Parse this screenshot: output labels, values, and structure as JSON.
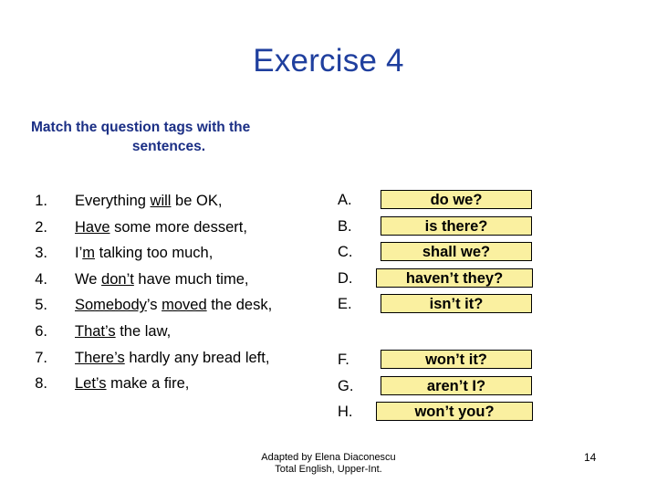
{
  "slide": {
    "title": "Exercise 4",
    "title_color": "#1F3F9E",
    "subtitle_line1": "Match the question tags with the",
    "subtitle_line2": "sentences.",
    "subtitle_color": "#1B2F85",
    "background_color": "#FFFFFF"
  },
  "questions": [
    {
      "num": "1.",
      "pre": "Everything ",
      "underline": "will",
      "post": " be OK,"
    },
    {
      "num": "2.",
      "pre": "",
      "underline": "Have",
      "post": " some more dessert,"
    },
    {
      "num": "3.",
      "pre": "I’",
      "underline": "m",
      "post": " talking too much,"
    },
    {
      "num": "4.",
      "pre": "We ",
      "underline": "don’t",
      "post": " have much time,"
    },
    {
      "num": "5.",
      "pre": "",
      "underline": "Somebody",
      "mid": "’s ",
      "underline2": "moved",
      "post": " the desk,"
    },
    {
      "num": "6.",
      "pre": "",
      "underline": "That’s",
      "post": " the law,"
    },
    {
      "num": "7.",
      "pre": "",
      "underline": "There’s",
      "post": " hardly any bread left,"
    },
    {
      "num": "8.",
      "pre": "",
      "underline": "Let’s",
      "post": " make a fire,"
    }
  ],
  "answers": [
    {
      "letter": "A.",
      "text": "do we?",
      "wide": false
    },
    {
      "letter": "B.",
      "text": "is there?",
      "wide": false
    },
    {
      "letter": "C.",
      "text": "shall we?",
      "wide": false
    },
    {
      "letter": "D.",
      "text": "haven’t they?",
      "wide": true
    },
    {
      "letter": "E.",
      "text": "isn’t it?",
      "wide": false
    },
    {
      "letter": "F.",
      "text": "won’t it?",
      "wide": false
    },
    {
      "letter": "G.",
      "text": "aren’t I?",
      "wide": false
    },
    {
      "letter": "H.",
      "text": "won’t you?",
      "wide": true
    }
  ],
  "answer_box_style": {
    "fill": "#FAF0A0",
    "border": "#000000"
  },
  "footer": {
    "line1": "Adapted by Elena Diaconescu",
    "line2": "Total English, Upper-Int."
  },
  "page_number": "14"
}
